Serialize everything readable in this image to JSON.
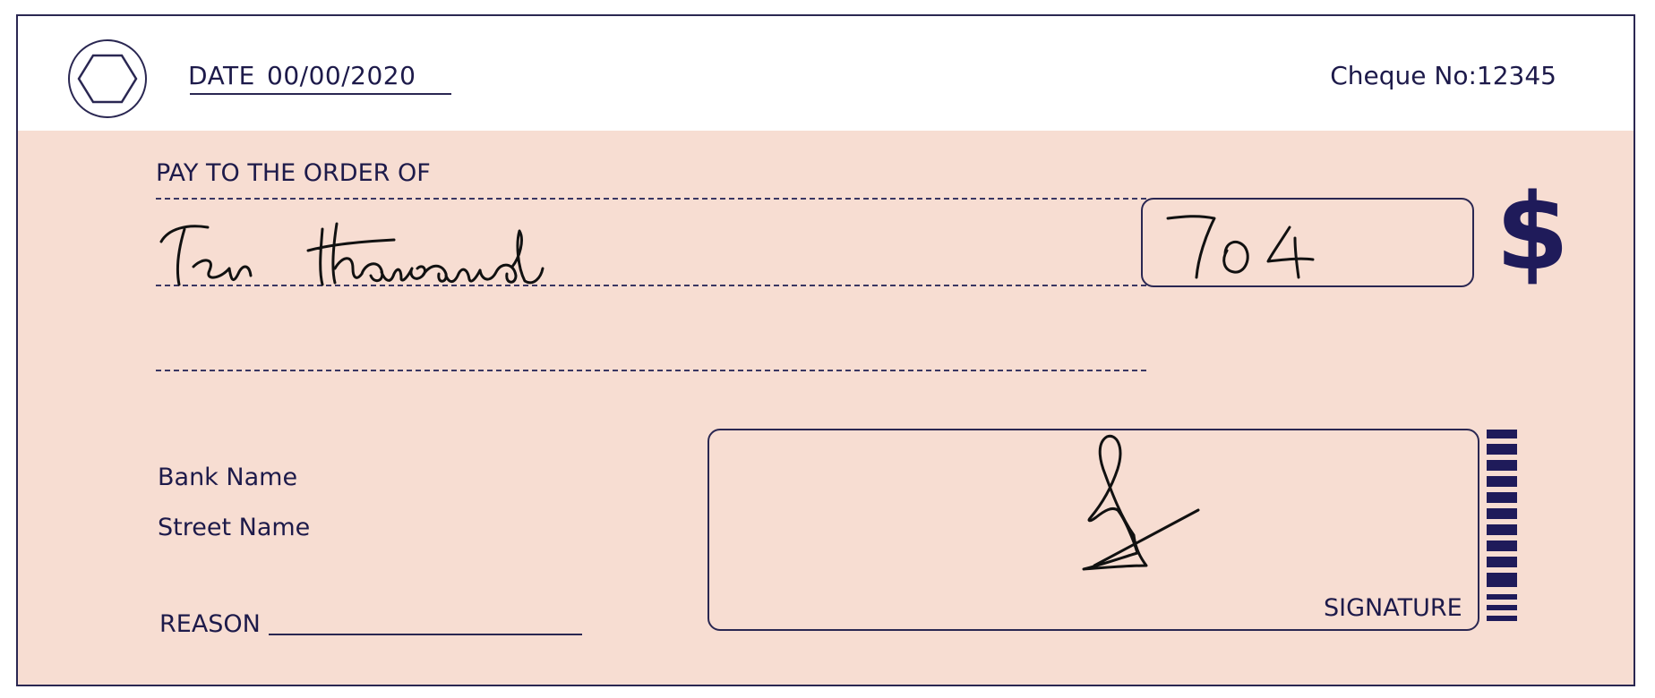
{
  "header": {
    "date_label": "DATE",
    "date_value": "00/00/2020",
    "cheque_no": "Cheque No:12345"
  },
  "payee": {
    "label": "PAY TO THE ORDER OF",
    "handwritten_amount_words": "Ten thousand"
  },
  "amount": {
    "handwritten_value": "704",
    "currency_symbol": "$"
  },
  "bank": {
    "name": "Bank Name",
    "street": "Street Name"
  },
  "reason": {
    "label": "REASON"
  },
  "signature": {
    "label": "SIGNATURE"
  },
  "colors": {
    "ink": "#1d1a4a",
    "body_band": "#f7ddd2",
    "border": "#2a2752"
  },
  "icons": {
    "logo": "hexagon-logo-icon",
    "currency": "dollar-icon",
    "barcode": "barcode-icon"
  }
}
